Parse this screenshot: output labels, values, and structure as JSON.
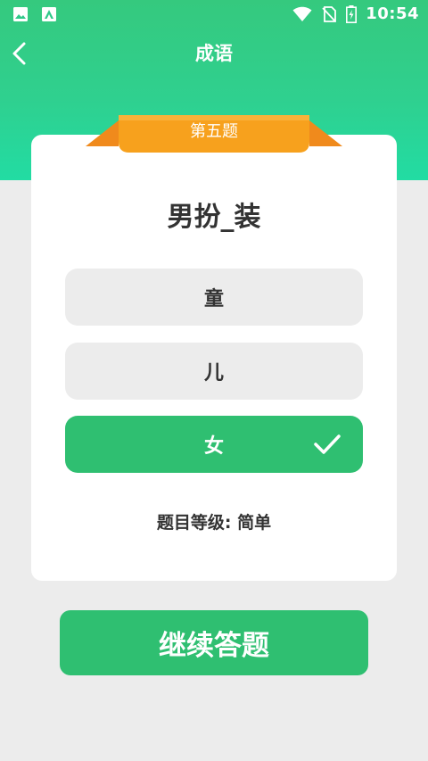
{
  "status_bar": {
    "time": "10:54",
    "left_icons": [
      "image-icon",
      "app-notification-icon"
    ],
    "right_icons": [
      "wifi-icon",
      "no-sim-icon",
      "battery-charging-icon"
    ]
  },
  "nav": {
    "back_icon": "chevron-left-icon",
    "title": "成语"
  },
  "quiz": {
    "ribbon_label": "第五题",
    "question": "男扮_装",
    "options": [
      {
        "label": "童",
        "state": "default"
      },
      {
        "label": "儿",
        "state": "default"
      },
      {
        "label": "女",
        "state": "correct"
      }
    ],
    "level_text": "题目等级: 简单"
  },
  "actions": {
    "continue_label": "继续答题"
  },
  "colors": {
    "header_top": "#35c97e",
    "header_bottom": "#22dca3",
    "accent_green": "#2fbf71",
    "ribbon_orange": "#f7a11d",
    "page_bg": "#ececec"
  }
}
